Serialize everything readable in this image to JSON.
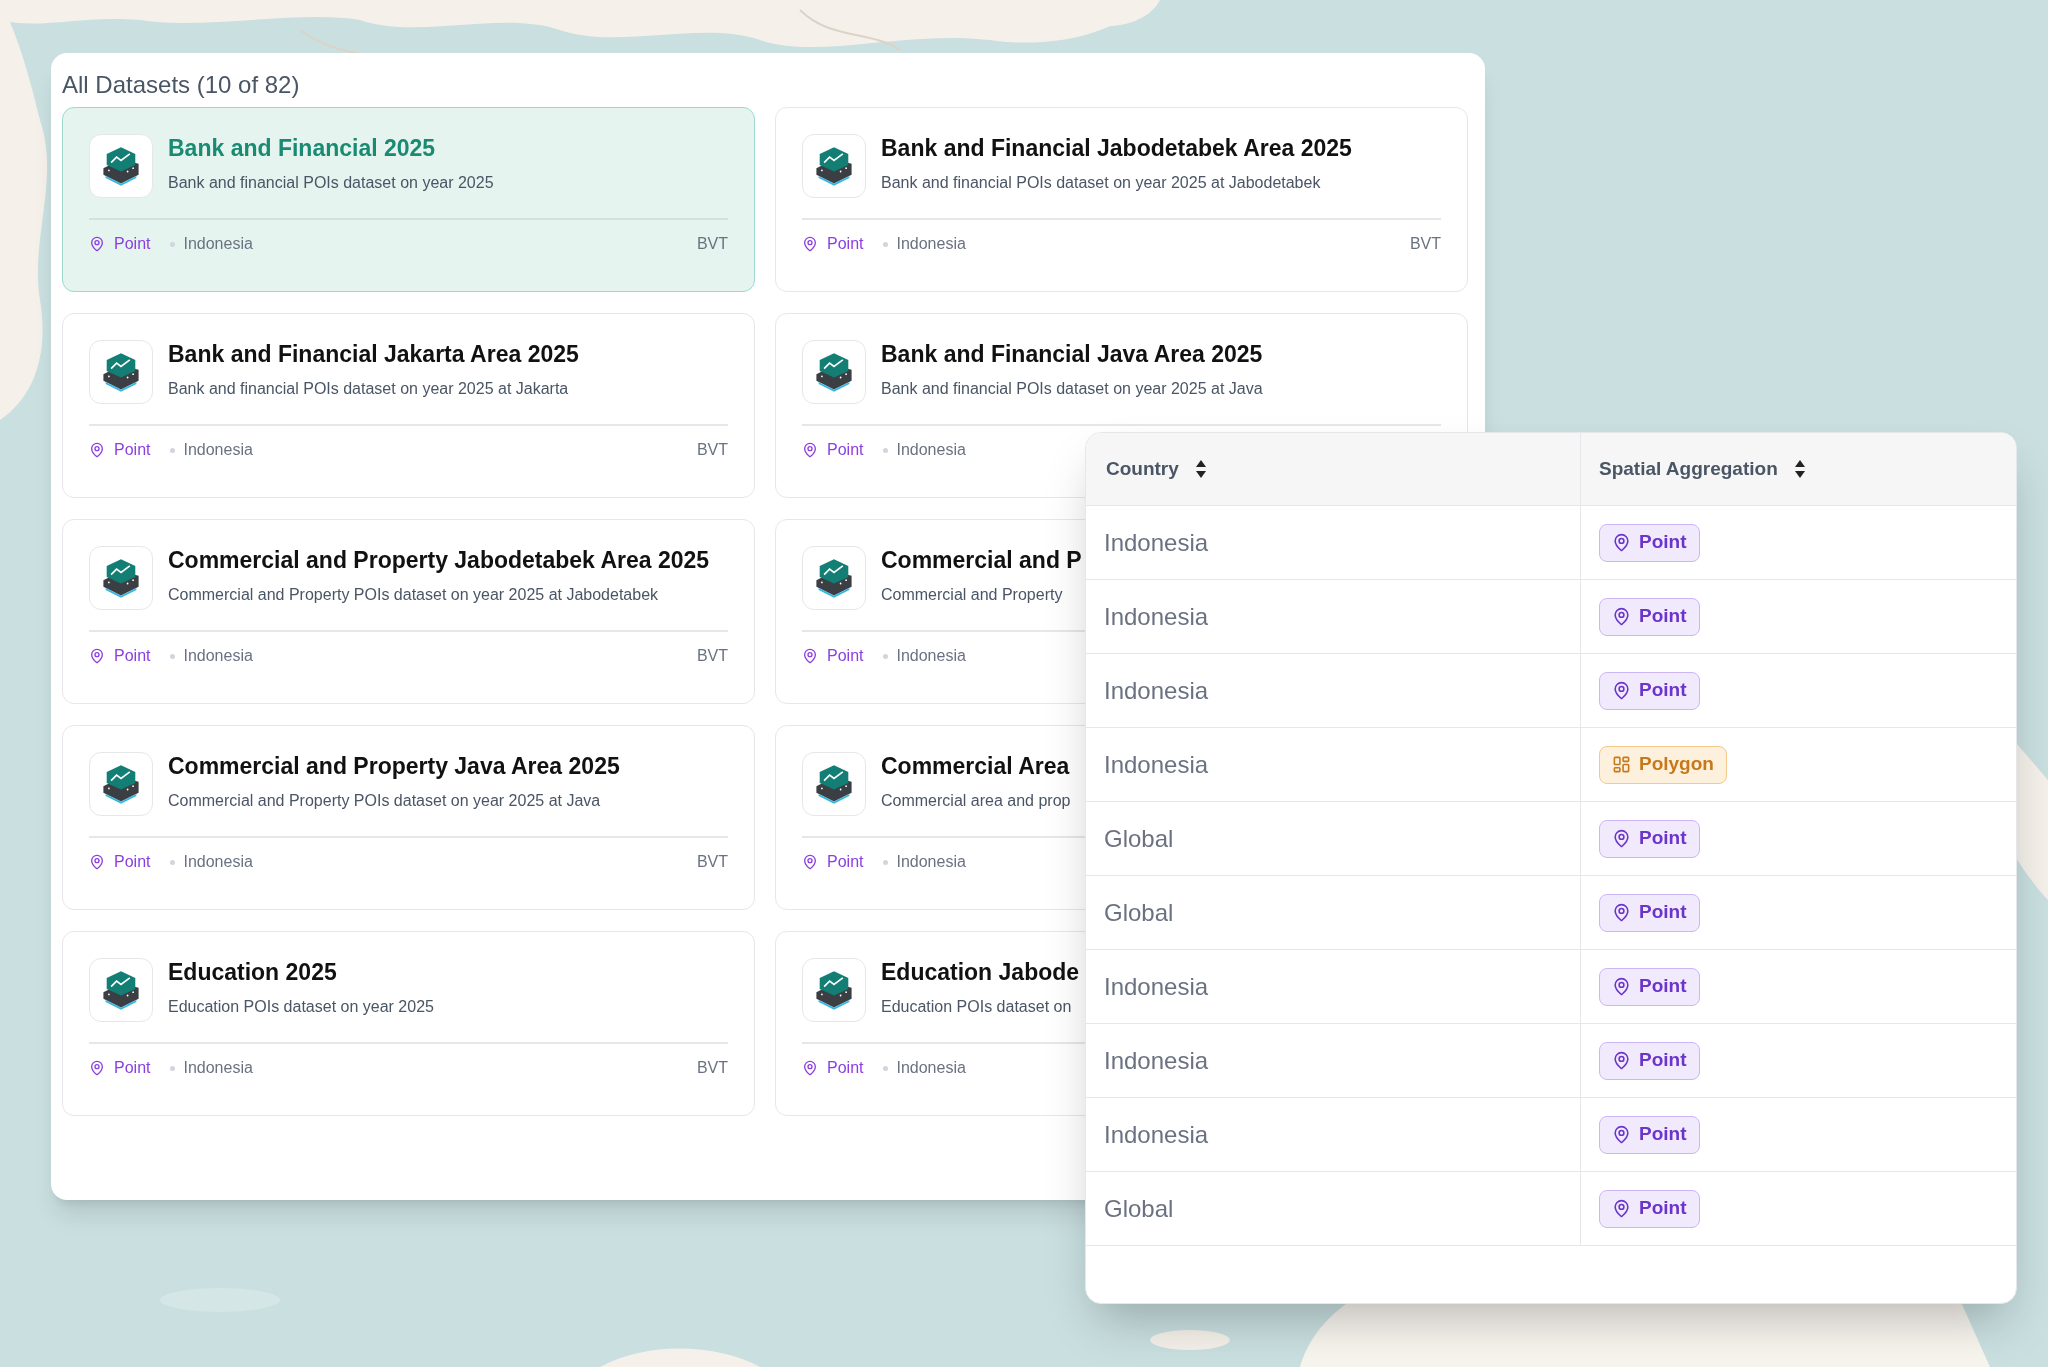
{
  "panel": {
    "title": "All Datasets (10 of 82)",
    "cards": [
      {
        "title": "Bank and Financial 2025",
        "description": "Bank and financial POIs dataset on year 2025",
        "type": "Point",
        "country": "Indonesia",
        "source": "BVT",
        "selected": true
      },
      {
        "title": "Bank and Financial Jabodetabek Area 2025",
        "description": "Bank and financial POIs dataset on year 2025 at Jabodetabek",
        "type": "Point",
        "country": "Indonesia",
        "source": "BVT",
        "selected": false
      },
      {
        "title": "Bank and Financial Jakarta Area 2025",
        "description": "Bank and financial POIs dataset on year 2025 at Jakarta",
        "type": "Point",
        "country": "Indonesia",
        "source": "BVT",
        "selected": false
      },
      {
        "title": "Bank and Financial Java Area 2025",
        "description": "Bank and financial POIs dataset on year 2025 at Java",
        "type": "Point",
        "country": "Indonesia",
        "selected": false
      },
      {
        "title": "Commercial and Property Jabodetabek Area 2025",
        "description": "Commercial and Property POIs dataset on year 2025 at Jabodetabek",
        "type": "Point",
        "country": "Indonesia",
        "source": "BVT",
        "selected": false
      },
      {
        "title": "Commercial and P",
        "description": "Commercial and Property",
        "type": "Point",
        "country": "Indonesia",
        "selected": false
      },
      {
        "title": "Commercial and Property Java Area 2025",
        "description": "Commercial and Property POIs dataset on year 2025 at Java",
        "type": "Point",
        "country": "Indonesia",
        "source": "BVT",
        "selected": false
      },
      {
        "title": "Commercial Area",
        "description": "Commercial area and prop",
        "type": "Point",
        "country": "Indonesia",
        "selected": false
      },
      {
        "title": "Education 2025",
        "description": "Education POIs dataset on year 2025",
        "type": "Point",
        "country": "Indonesia",
        "source": "BVT",
        "selected": false
      },
      {
        "title": "Education Jabode",
        "description": "Education POIs dataset on",
        "type": "Point",
        "country": "Indonesia",
        "selected": false
      }
    ]
  },
  "table": {
    "columns": [
      {
        "label": "Country"
      },
      {
        "label": "Spatial Aggregation"
      }
    ],
    "rows": [
      {
        "country": "Indonesia",
        "aggregation": {
          "kind": "point",
          "label": "Point"
        }
      },
      {
        "country": "Indonesia",
        "aggregation": {
          "kind": "point",
          "label": "Point"
        }
      },
      {
        "country": "Indonesia",
        "aggregation": {
          "kind": "point",
          "label": "Point"
        }
      },
      {
        "country": "Indonesia",
        "aggregation": {
          "kind": "polygon",
          "label": "Polygon"
        }
      },
      {
        "country": "Global",
        "aggregation": {
          "kind": "point",
          "label": "Point"
        }
      },
      {
        "country": "Global",
        "aggregation": {
          "kind": "point",
          "label": "Point"
        }
      },
      {
        "country": "Indonesia",
        "aggregation": {
          "kind": "point",
          "label": "Point"
        }
      },
      {
        "country": "Indonesia",
        "aggregation": {
          "kind": "point",
          "label": "Point"
        }
      },
      {
        "country": "Indonesia",
        "aggregation": {
          "kind": "point",
          "label": "Point"
        }
      },
      {
        "country": "Global",
        "aggregation": {
          "kind": "point",
          "label": "Point"
        }
      }
    ]
  }
}
